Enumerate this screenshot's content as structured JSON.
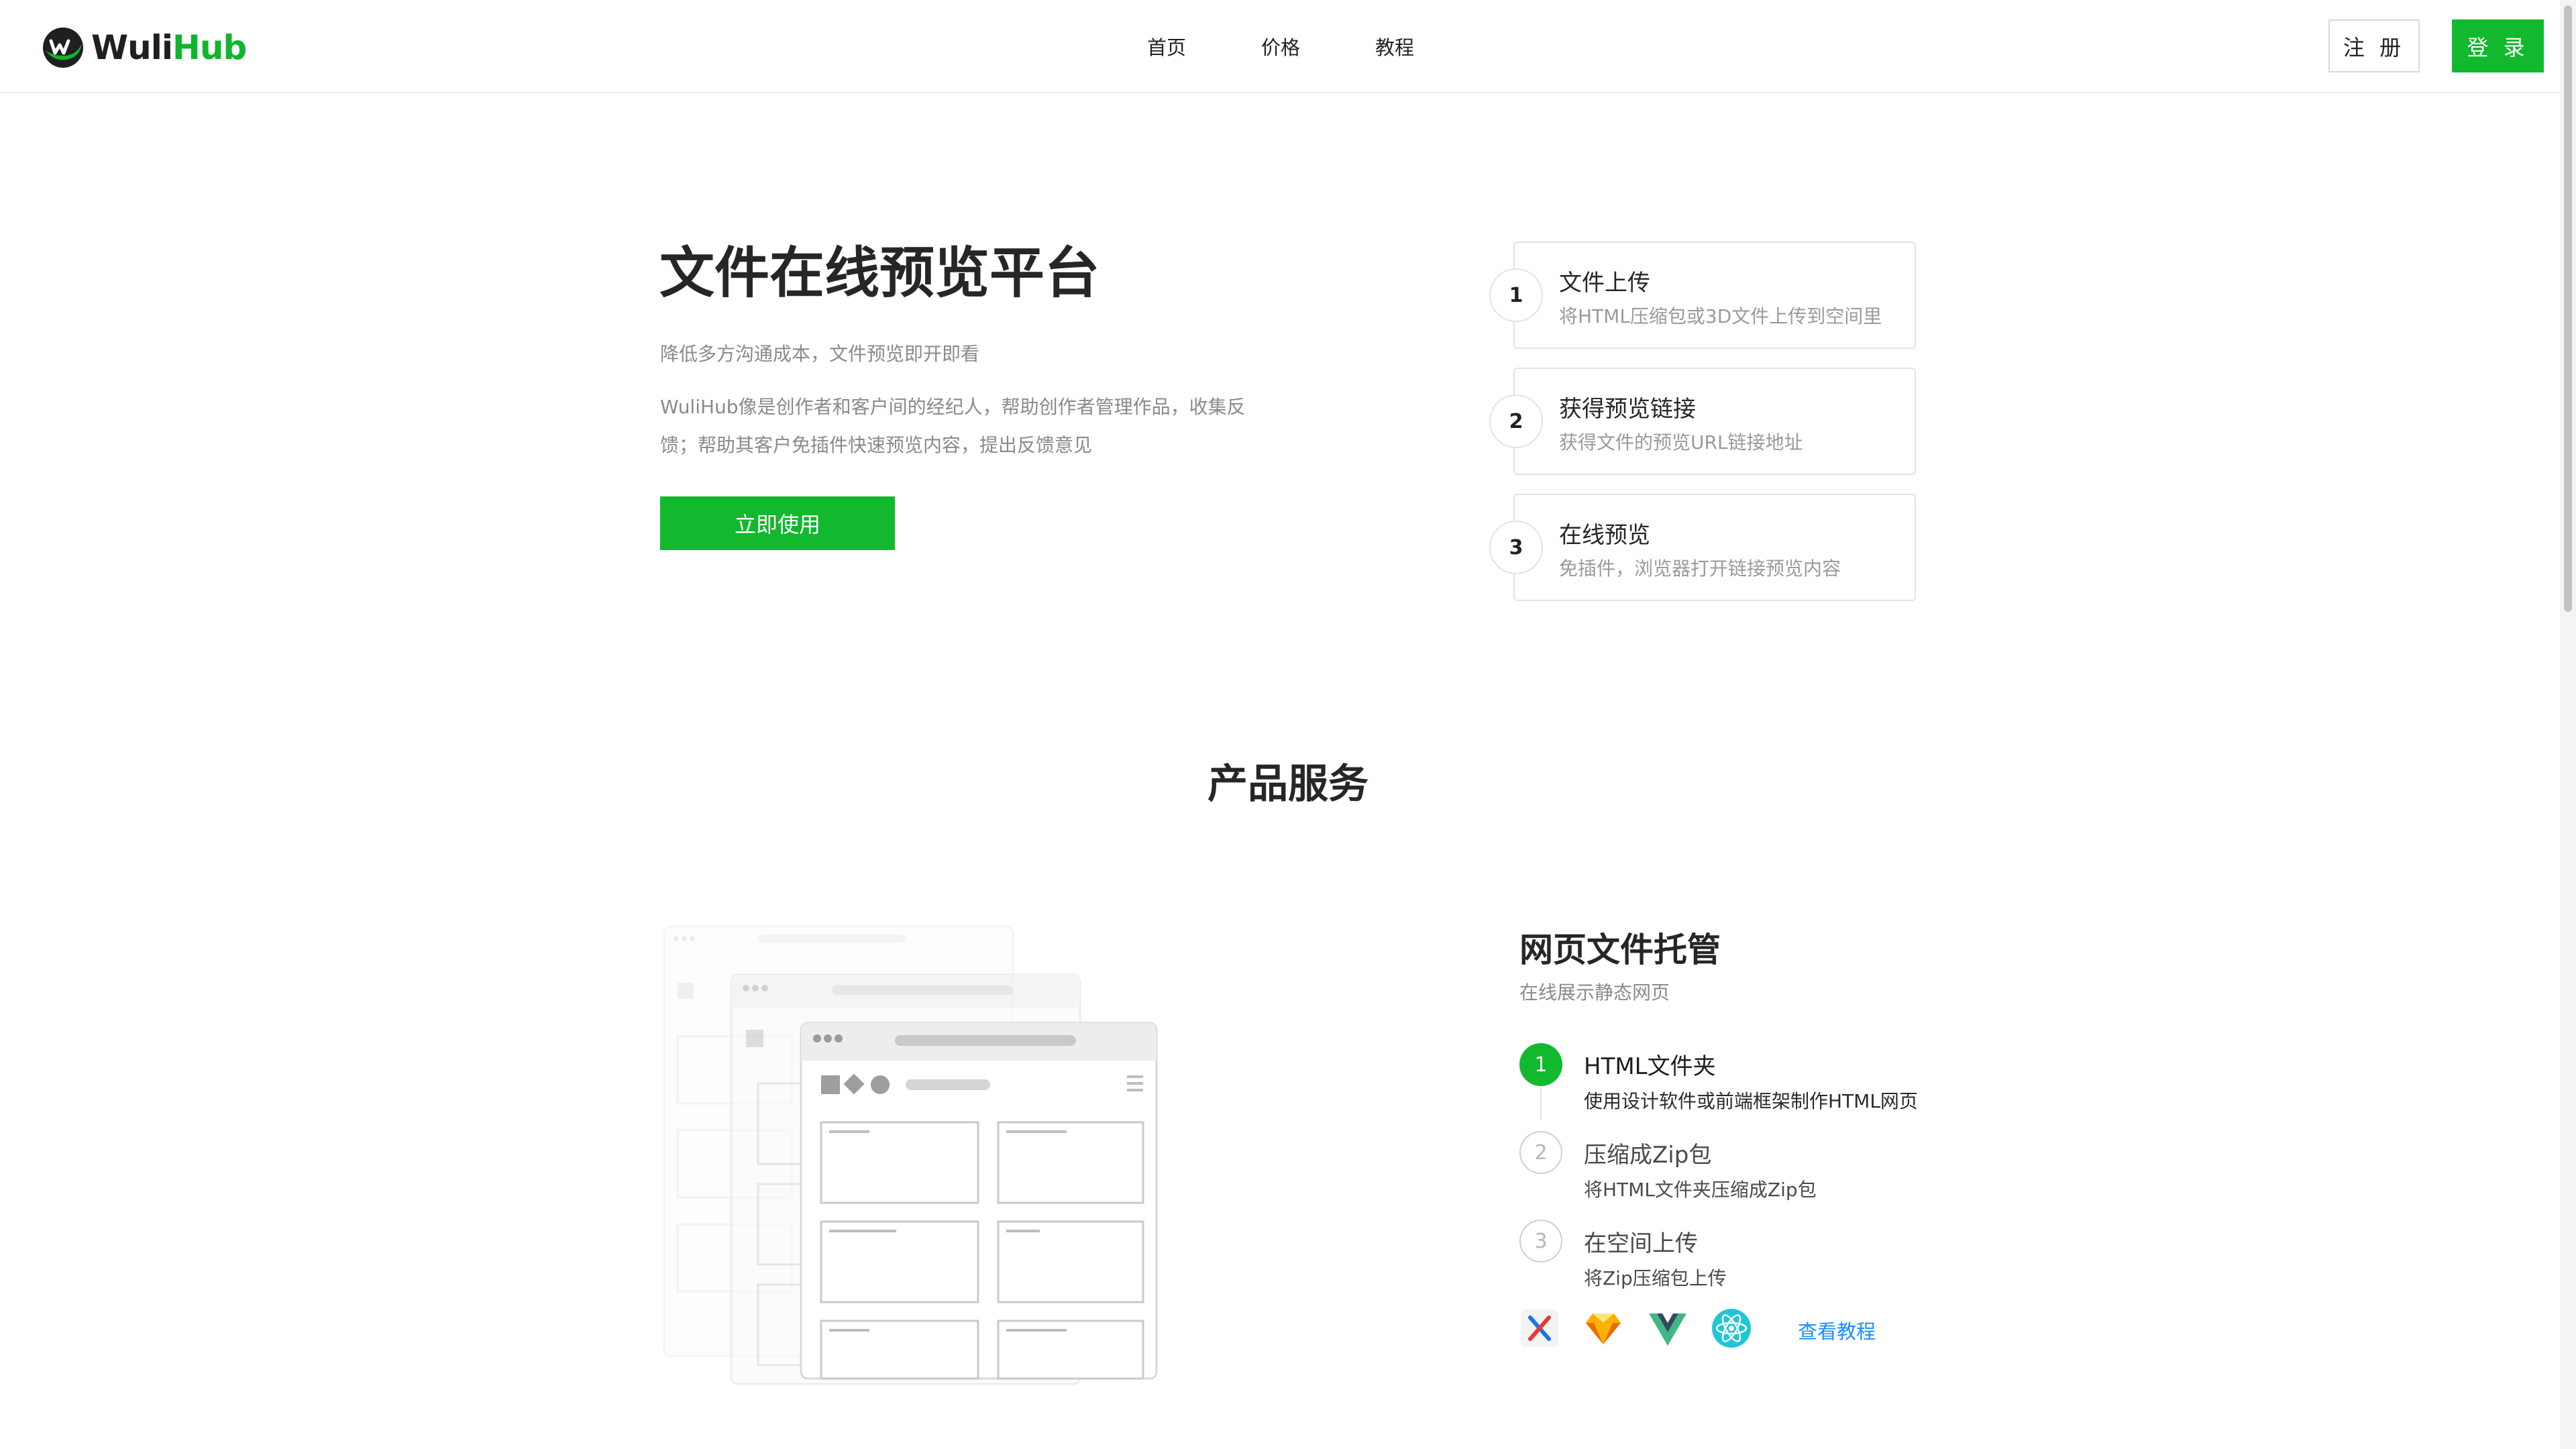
{
  "header": {
    "logo_text_a": "Wuli",
    "logo_text_b": "Hub",
    "nav": [
      {
        "label": "首页"
      },
      {
        "label": "价格"
      },
      {
        "label": "教程"
      }
    ],
    "register_label": "注 册",
    "login_label": "登 录",
    "accent_color": "#12b82e"
  },
  "hero": {
    "title": "文件在线预览平台",
    "subtitle": "降低多方沟通成本，文件预览即开即看",
    "description": "WuliHub像是创作者和客户间的经纪人，帮助创作者管理作品，收集反馈；帮助其客户免插件快速预览内容，提出反馈意见",
    "cta_label": "立即使用",
    "steps": [
      {
        "num": "1",
        "title": "文件上传",
        "desc": "将HTML压缩包或3D文件上传到空间里"
      },
      {
        "num": "2",
        "title": "获得预览链接",
        "desc": "获得文件的预览URL链接地址"
      },
      {
        "num": "3",
        "title": "在线预览",
        "desc": "免插件，浏览器打开链接预览内容"
      }
    ]
  },
  "products": {
    "section_title": "产品服务",
    "service": {
      "title": "网页文件托管",
      "subtitle": "在线展示静态网页",
      "steps": [
        {
          "num": "1",
          "title": "HTML文件夹",
          "desc": "使用设计软件或前端框架制作HTML网页",
          "state": "active"
        },
        {
          "num": "2",
          "title": "压缩成Zip包",
          "desc": "将HTML文件夹压缩成Zip包",
          "state": "idle"
        },
        {
          "num": "3",
          "title": "在空间上传",
          "desc": "将Zip压缩包上传",
          "state": "idle"
        }
      ],
      "tools": [
        "axure-icon",
        "sketch-icon",
        "vue-icon",
        "react-icon"
      ],
      "tutorial_link": "查看教程"
    }
  }
}
